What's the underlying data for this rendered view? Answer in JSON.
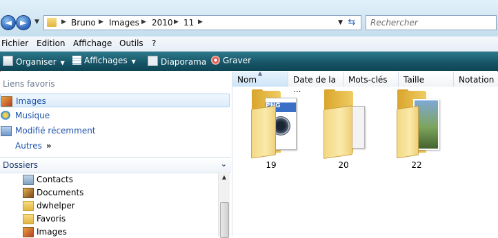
{
  "address": {
    "breadcrumbs": [
      "Bruno",
      "Images",
      "2010",
      "11"
    ]
  },
  "search": {
    "placeholder": "Rechercher"
  },
  "menu": [
    "Fichier",
    "Edition",
    "Affichage",
    "Outils",
    "?"
  ],
  "toolbar": {
    "organize": "Organiser",
    "views": "Affichages",
    "slideshow": "Diaporama",
    "burn": "Graver"
  },
  "nav": {
    "favorites_title": "Liens favoris",
    "favorites": [
      {
        "label": "Images",
        "icon": "pictures-icon",
        "selected": true
      },
      {
        "label": "Musique",
        "icon": "music-icon"
      },
      {
        "label": "Modifié récemment",
        "icon": "recent-icon"
      },
      {
        "label": "Autres",
        "icon": "more-icon"
      }
    ],
    "more_chevron": "»",
    "folders_title": "Dossiers",
    "tree": [
      {
        "label": "Contacts",
        "icon": "contacts-icon"
      },
      {
        "label": "Documents",
        "icon": "documents-icon"
      },
      {
        "label": "dwhelper",
        "icon": "folder-icon"
      },
      {
        "label": "Favoris",
        "icon": "favorites-folder-icon"
      },
      {
        "label": "Images",
        "icon": "pictures-icon"
      }
    ]
  },
  "columns": [
    "Nom",
    "Date de la ...",
    "Mots-clés",
    "Taille",
    "Notation"
  ],
  "items": [
    {
      "label": "19",
      "type": "folder-with-png"
    },
    {
      "label": "20",
      "type": "folder-empty"
    },
    {
      "label": "22",
      "type": "folder-with-photos"
    }
  ],
  "icons": {
    "back": "◄",
    "forward": "►",
    "png_tag": "PNG"
  }
}
